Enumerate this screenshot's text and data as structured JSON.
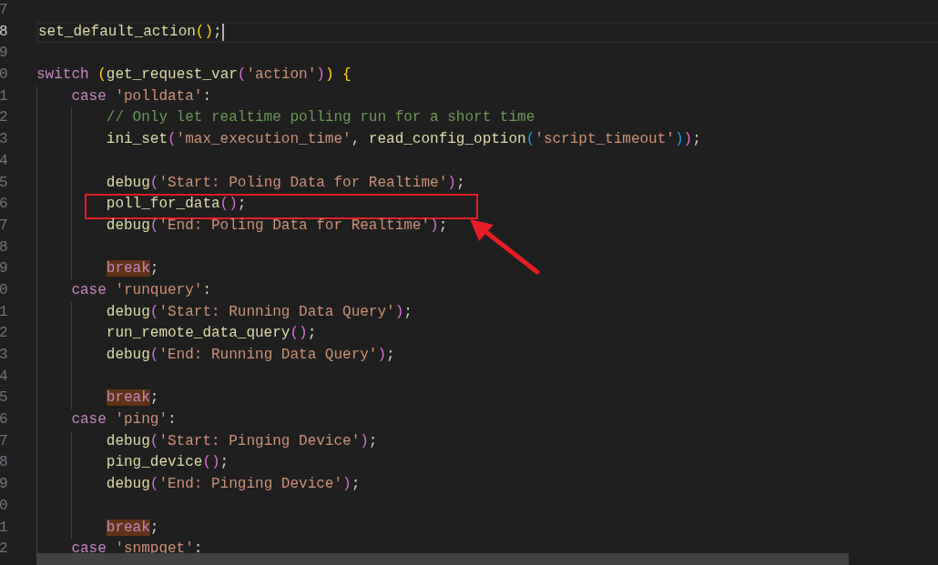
{
  "editor": {
    "lines": [
      {
        "number": "7",
        "current": false
      },
      {
        "number": "8",
        "current": true,
        "tokens": [
          {
            "kind": "fn",
            "text": "set_default_action"
          },
          {
            "kind": "b1",
            "text": "()"
          },
          {
            "kind": "punct",
            "text": ";"
          }
        ]
      },
      {
        "number": "9",
        "current": false
      },
      {
        "number": "0",
        "current": false,
        "tokens": [
          {
            "kind": "kw",
            "text": "switch "
          },
          {
            "kind": "b1",
            "text": "("
          },
          {
            "kind": "fn",
            "text": "get_request_var"
          },
          {
            "kind": "b2",
            "text": "("
          },
          {
            "kind": "str",
            "text": "'action'"
          },
          {
            "kind": "b2",
            "text": ")"
          },
          {
            "kind": "b1",
            "text": ") {"
          }
        ],
        "children": [
          {
            "number": "1",
            "current": false,
            "tokens": [
              {
                "kind": "kw",
                "text": "case "
              },
              {
                "kind": "str",
                "text": "'polldata'"
              },
              {
                "kind": "punct",
                "text": ":"
              }
            ],
            "children": [
              {
                "number": "2",
                "current": false,
                "tokens": [
                  {
                    "kind": "cmt",
                    "text": "// Only let realtime polling run for a short time"
                  }
                ]
              },
              {
                "number": "3",
                "current": false,
                "tokens": [
                  {
                    "kind": "fn",
                    "text": "ini_set"
                  },
                  {
                    "kind": "b2",
                    "text": "("
                  },
                  {
                    "kind": "str",
                    "text": "'max_execution_time'"
                  },
                  {
                    "kind": "punct",
                    "text": ", "
                  },
                  {
                    "kind": "fn",
                    "text": "read_config_option"
                  },
                  {
                    "kind": "b3",
                    "text": "("
                  },
                  {
                    "kind": "str",
                    "text": "'script_timeout'"
                  },
                  {
                    "kind": "b3",
                    "text": ")"
                  },
                  {
                    "kind": "b2",
                    "text": ")"
                  },
                  {
                    "kind": "punct",
                    "text": ";"
                  }
                ]
              },
              {
                "number": "4",
                "current": false
              },
              {
                "number": "5",
                "current": false,
                "tokens": [
                  {
                    "kind": "fn",
                    "text": "debug"
                  },
                  {
                    "kind": "b2",
                    "text": "("
                  },
                  {
                    "kind": "str",
                    "text": "'Start: Poling Data for Realtime'"
                  },
                  {
                    "kind": "b2",
                    "text": ")"
                  },
                  {
                    "kind": "punct",
                    "text": ";"
                  }
                ]
              },
              {
                "number": "6",
                "current": false,
                "annotated": true,
                "tokens": [
                  {
                    "kind": "fn",
                    "text": "poll_for_data"
                  },
                  {
                    "kind": "b2",
                    "text": "()"
                  },
                  {
                    "kind": "punct",
                    "text": ";"
                  }
                ]
              },
              {
                "number": "7",
                "current": false,
                "tokens": [
                  {
                    "kind": "fn",
                    "text": "debug"
                  },
                  {
                    "kind": "b2",
                    "text": "("
                  },
                  {
                    "kind": "str",
                    "text": "'End: Poling Data for Realtime'"
                  },
                  {
                    "kind": "b2",
                    "text": ")"
                  },
                  {
                    "kind": "punct",
                    "text": ";"
                  }
                ]
              },
              {
                "number": "8",
                "current": false
              },
              {
                "number": "9",
                "current": false,
                "tokens": [
                  {
                    "kind": "kwhl",
                    "text": "break"
                  },
                  {
                    "kind": "punct",
                    "text": ";"
                  }
                ]
              }
            ]
          },
          {
            "number": "0",
            "current": false,
            "tokens": [
              {
                "kind": "kw",
                "text": "case "
              },
              {
                "kind": "str",
                "text": "'runquery'"
              },
              {
                "kind": "punct",
                "text": ":"
              }
            ],
            "children": [
              {
                "number": "1",
                "current": false,
                "tokens": [
                  {
                    "kind": "fn",
                    "text": "debug"
                  },
                  {
                    "kind": "b2",
                    "text": "("
                  },
                  {
                    "kind": "str",
                    "text": "'Start: Running Data Query'"
                  },
                  {
                    "kind": "b2",
                    "text": ")"
                  },
                  {
                    "kind": "punct",
                    "text": ";"
                  }
                ]
              },
              {
                "number": "2",
                "current": false,
                "tokens": [
                  {
                    "kind": "fn",
                    "text": "run_remote_data_query"
                  },
                  {
                    "kind": "b2",
                    "text": "()"
                  },
                  {
                    "kind": "punct",
                    "text": ";"
                  }
                ]
              },
              {
                "number": "3",
                "current": false,
                "tokens": [
                  {
                    "kind": "fn",
                    "text": "debug"
                  },
                  {
                    "kind": "b2",
                    "text": "("
                  },
                  {
                    "kind": "str",
                    "text": "'End: Running Data Query'"
                  },
                  {
                    "kind": "b2",
                    "text": ")"
                  },
                  {
                    "kind": "punct",
                    "text": ";"
                  }
                ]
              },
              {
                "number": "4",
                "current": false
              },
              {
                "number": "5",
                "current": false,
                "tokens": [
                  {
                    "kind": "kwhl",
                    "text": "break"
                  },
                  {
                    "kind": "punct",
                    "text": ";"
                  }
                ]
              }
            ]
          },
          {
            "number": "6",
            "current": false,
            "tokens": [
              {
                "kind": "kw",
                "text": "case "
              },
              {
                "kind": "str",
                "text": "'ping'"
              },
              {
                "kind": "punct",
                "text": ":"
              }
            ],
            "children": [
              {
                "number": "7",
                "current": false,
                "tokens": [
                  {
                    "kind": "fn",
                    "text": "debug"
                  },
                  {
                    "kind": "b2",
                    "text": "("
                  },
                  {
                    "kind": "str",
                    "text": "'Start: Pinging Device'"
                  },
                  {
                    "kind": "b2",
                    "text": ")"
                  },
                  {
                    "kind": "punct",
                    "text": ";"
                  }
                ]
              },
              {
                "number": "8",
                "current": false,
                "tokens": [
                  {
                    "kind": "fn",
                    "text": "ping_device"
                  },
                  {
                    "kind": "b2",
                    "text": "()"
                  },
                  {
                    "kind": "punct",
                    "text": ";"
                  }
                ]
              },
              {
                "number": "9",
                "current": false,
                "tokens": [
                  {
                    "kind": "fn",
                    "text": "debug"
                  },
                  {
                    "kind": "b2",
                    "text": "("
                  },
                  {
                    "kind": "str",
                    "text": "'End: Pinging Device'"
                  },
                  {
                    "kind": "b2",
                    "text": ")"
                  },
                  {
                    "kind": "punct",
                    "text": ";"
                  }
                ]
              },
              {
                "number": "0",
                "current": false
              },
              {
                "number": "1",
                "current": false,
                "tokens": [
                  {
                    "kind": "kwhl",
                    "text": "break"
                  },
                  {
                    "kind": "punct",
                    "text": ";"
                  }
                ]
              }
            ]
          },
          {
            "number": "2",
            "current": false,
            "tokens": [
              {
                "kind": "kw",
                "text": "case "
              },
              {
                "kind": "str",
                "text": "'snmpget'"
              },
              {
                "kind": "punct",
                "text": ":"
              }
            ]
          }
        ]
      }
    ]
  }
}
